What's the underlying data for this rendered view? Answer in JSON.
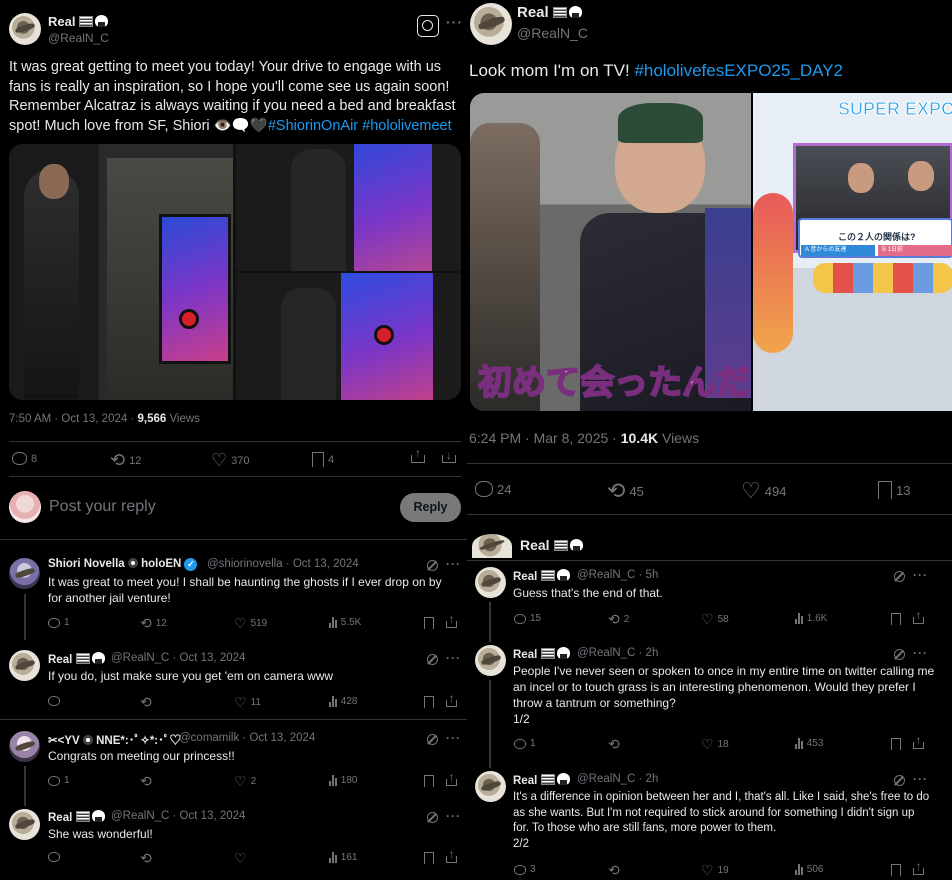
{
  "left": {
    "main": {
      "display_name": "Real",
      "handle": "@RealN_C",
      "text": "It was great getting to meet you today! Your drive to engage with us fans is really an inspiration, so I hope you'll come see us again soon! Remember Alcatraz is always waiting if you need a bed and breakfast spot! Much love from SF, Shiori ",
      "emoji": "👁️🗨️🖤",
      "hashtag1": "#ShiorinOnAir",
      "hashtag2": "#hololivemeet",
      "time": "7:50 AM · Oct 13, 2024 · ",
      "views_num": "9,566",
      "views_label": " Views",
      "actions": {
        "reply": "8",
        "retweet": "12",
        "like": "370",
        "bookmark": "4"
      }
    },
    "compose": {
      "placeholder": "Post your reply",
      "button": "Reply"
    },
    "replies": [
      {
        "name": "Shiori Novella",
        "suffix": "holoEN",
        "handle": "@shiorinovella · Oct 13, 2024",
        "text": "It was great to meet you! I shall be haunting the ghosts if I ever drop on by for another jail venture!",
        "reply": "1",
        "retweet": "12",
        "like": "519",
        "views": "5.5K"
      },
      {
        "name": "Real",
        "handle": "@RealN_C · Oct 13, 2024",
        "text": "If you do, just make sure you get 'em on camera www",
        "reply": "",
        "retweet": "",
        "like": "11",
        "views": "428"
      },
      {
        "name": "✂︎<YV",
        "suffix": "NNE*:･ﾟ✧*:･ﾟ♡",
        "handle": "@comamilk · Oct 13, 2024",
        "text": "Congrats on meeting our princess!!",
        "reply": "1",
        "retweet": "",
        "like": "2",
        "views": "180"
      },
      {
        "name": "Real",
        "handle": "@RealN_C · Oct 13, 2024",
        "text": "She was wonderful!",
        "reply": "",
        "retweet": "",
        "like": "",
        "views": "161"
      }
    ]
  },
  "right": {
    "main": {
      "display_name": "Real",
      "handle": "@RealN_C",
      "text": "Look mom I'm on TV! ",
      "hashtag": "#hololivefesEXPO25_DAY2",
      "caption": "初めて会ったんだ",
      "tv_banner": "SUPER EXPO",
      "tv_question": "この２人の関係は?",
      "tv_answer_a": "A 昔からの友達",
      "tv_answer_b": "B 1日前",
      "time": "6:24 PM · Mar 8, 2025 · ",
      "views_num": "10.4K",
      "views_label": " Views",
      "actions": {
        "reply": "24",
        "retweet": "45",
        "like": "494",
        "bookmark": "13"
      }
    },
    "thread_head": {
      "name": "Real"
    },
    "replies": [
      {
        "name": "Real",
        "handle": "@RealN_C · 5h",
        "text": "Guess that's the end of that.",
        "reply": "15",
        "retweet": "2",
        "like": "58",
        "views": "1.6K"
      },
      {
        "name": "Real",
        "handle": "@RealN_C · 2h",
        "text": "People I've never seen or spoken to once in my entire time on twitter calling me an incel or to touch grass is an interesting phenomenon. Would they prefer I throw a tantrum or something?\n1/2",
        "reply": "1",
        "retweet": "",
        "like": "18",
        "views": "453"
      },
      {
        "name": "Real",
        "handle": "@RealN_C · 2h",
        "text": "It's a difference in opinion between her and I, that's all. Like I said, she's free to do as she wants. But I'm not required to stick around for something I didn't sign up for. To those who are still fans, more power to them.\n2/2",
        "reply": "3",
        "retweet": "",
        "like": "19",
        "views": "506"
      }
    ]
  }
}
